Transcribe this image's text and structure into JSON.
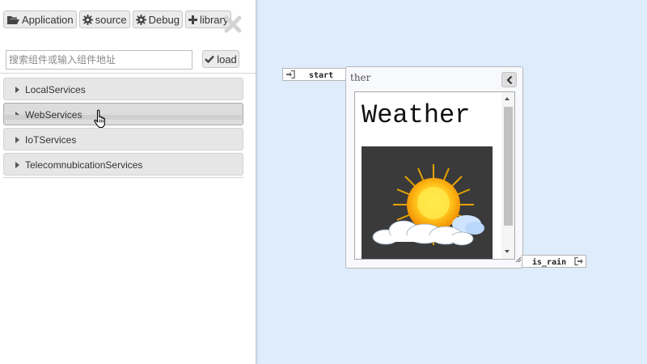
{
  "toolbar": {
    "application_label": "Application",
    "source_label": "source",
    "debug_label": "Debug",
    "library_label": "library"
  },
  "search": {
    "placeholder": "搜索组件或输入组件地址",
    "value": "",
    "load_label": "load"
  },
  "services": [
    {
      "label": "LocalServices"
    },
    {
      "label": "WebServices"
    },
    {
      "label": "IoTServices"
    },
    {
      "label": "TelecomnubicationServices"
    }
  ],
  "node": {
    "title": "ther",
    "input_port": "start",
    "output_port": "is_rain",
    "content_heading": "Weather"
  },
  "colors": {
    "canvas_bg": "#deecfb",
    "panel_bg": "#ffffff",
    "button_bg": "#ebebeb",
    "accordion_bg": "#e6e6e6"
  },
  "icons": {
    "application": "folder-open-icon",
    "source": "gear-icon",
    "debug": "gear-icon",
    "library": "plus-icon",
    "close": "close-icon",
    "load": "check-icon",
    "collapse": "chevron-left-icon",
    "input_port": "sign-in-icon",
    "output_port": "sign-out-icon"
  }
}
